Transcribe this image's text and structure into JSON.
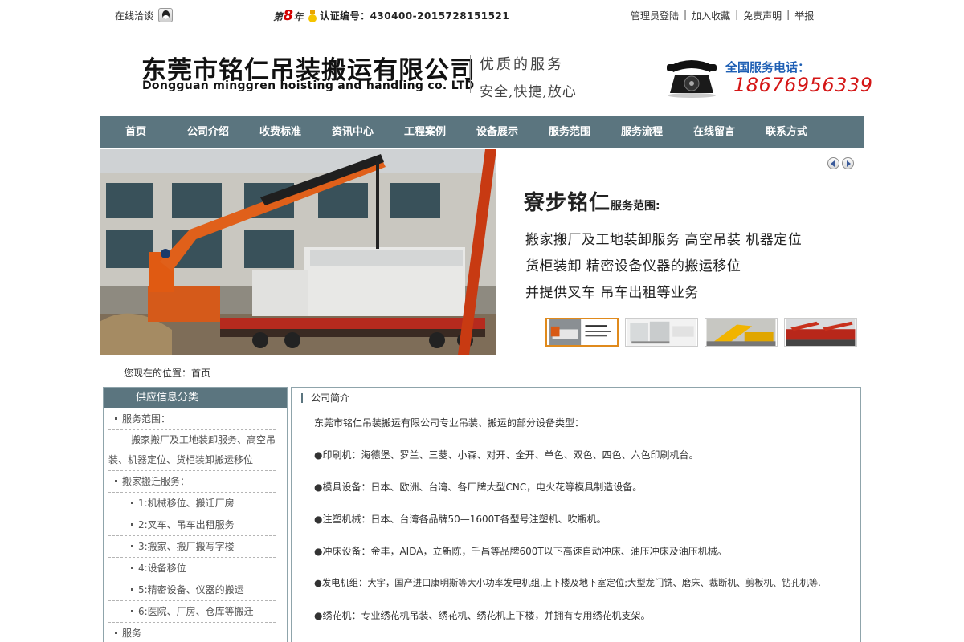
{
  "topbar": {
    "online_chat": "在线洽谈",
    "year_prefix": "第",
    "year_num": "8",
    "year_suffix": "年",
    "cert_label": "认证编号：430400-2015728151521",
    "links": [
      "管理员登陆",
      "加入收藏",
      "免责声明",
      "举报"
    ]
  },
  "header": {
    "company_cn": "东莞市铭仁吊装搬运有限公司",
    "company_en": "Dongguan minggren hoisting and handling co. LTD",
    "slogan1": "优质的服务",
    "slogan2": "安全,快捷,放心",
    "hotline_label": "全国服务电话：",
    "hotline_number": "18676956339"
  },
  "nav": {
    "items": [
      "首页",
      "公司介绍",
      "收费标准",
      "资讯中心",
      "工程案例",
      "设备展示",
      "服务范围",
      "服务流程",
      "在线留言",
      "联系方式"
    ]
  },
  "banner": {
    "title": "寮步铭仁",
    "title_suffix": "服务范围:",
    "lines": [
      "搬家搬厂及工地装卸服务 高空吊装 机器定位",
      "货柜装卸 精密设备仪器的搬运移位",
      "并提供叉车 吊车出租等业务"
    ]
  },
  "breadcrumb": "您现在的位置：首页",
  "sidebar": {
    "title": "供应信息分类",
    "cat1": "服务范围：",
    "cat1_desc": "搬家搬厂及工地装卸服务、高空吊装、机器定位、货柜装卸搬运移位",
    "cat2": "搬家搬迁服务：",
    "subs": [
      "1:机械移位、搬迁厂房",
      "2:叉车、吊车出租服务",
      "3:搬家、搬厂搬写字楼",
      "4:设备移位",
      "5:精密设备、仪器的搬运",
      "6:医院、厂房、仓库等搬迁"
    ],
    "cat3": "服务"
  },
  "main": {
    "title": "公司简介",
    "paragraphs": [
      "东莞市铭仁吊装搬运有限公司专业吊装、搬运的部分设备类型：",
      "●印刷机：海德堡、罗兰、三菱、小森、对开、全开、单色、双色、四色、六色印刷机台。",
      "●模具设备：日本、欧洲、台湾、各厂牌大型CNC，电火花等模具制造设备。",
      "●注塑机械：日本、台湾各品牌50—1600T各型号注塑机、吹瓶机。",
      "●冲床设备：金丰，AIDA，立新陈，千昌等品牌600T以下高速自动冲床、油压冲床及油压机械。",
      "●发电机组：大宇，国产进口康明斯等大小功率发电机组,上下楼及地下室定位;大型龙门铣、磨床、裁断机、剪板机、钻孔机等.",
      "●绣花机：专业绣花机吊装、绣花机、绣花机上下楼，并拥有专用绣花机支架。"
    ]
  }
}
